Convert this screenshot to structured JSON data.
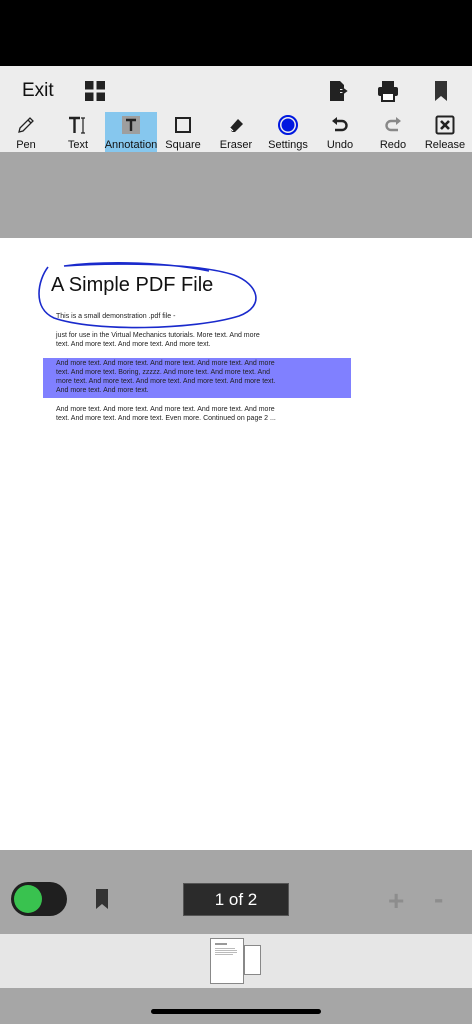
{
  "header": {
    "exit_label": "Exit",
    "icons": [
      "grid-icon",
      "export-icon",
      "print-icon",
      "bookmark-icon"
    ]
  },
  "toolbar": {
    "active_tool": "Annotation",
    "active_color": "#86c7ee",
    "tools": [
      {
        "label": "Pen",
        "icon": "pen-icon"
      },
      {
        "label": "Text",
        "icon": "text-cursor-icon"
      },
      {
        "label": "Annotation",
        "icon": "annotation-icon"
      },
      {
        "label": "Square",
        "icon": "square-icon"
      },
      {
        "label": "Eraser",
        "icon": "eraser-icon"
      },
      {
        "label": "Settings",
        "icon": "settings-circle-icon"
      },
      {
        "label": "Undo",
        "icon": "undo-icon"
      },
      {
        "label": "Redo",
        "icon": "redo-icon"
      },
      {
        "label": "Release",
        "icon": "release-icon"
      }
    ]
  },
  "document": {
    "title": "A Simple PDF File",
    "line1": "This is a small demonstration .pdf file -",
    "para1_l1": "just for use in the Virtual Mechanics tutorials. More text. And more",
    "para1_l2": "text. And more text. And more text. And more text.",
    "para2_l1": "And more text. And more text. And more text. And more text. And more",
    "para2_l2": "text. And more text. Boring, zzzzz. And more text. And more text. And",
    "para2_l3": "more text. And more text. And more text. And more text. And more text.",
    "para2_l4": "And more text. And more text.",
    "para3_l1": "And more text. And more text. And more text. And more text. And more",
    "para3_l2": "text. And more text. And more text. Even more. Continued on page 2 ...",
    "highlight_color": "#8080ff",
    "ink_color": "#1a2acc"
  },
  "footer": {
    "page_indicator": "1 of 2",
    "zoom_in": "+",
    "zoom_out": "-",
    "toggle_color": "#39c24f"
  }
}
